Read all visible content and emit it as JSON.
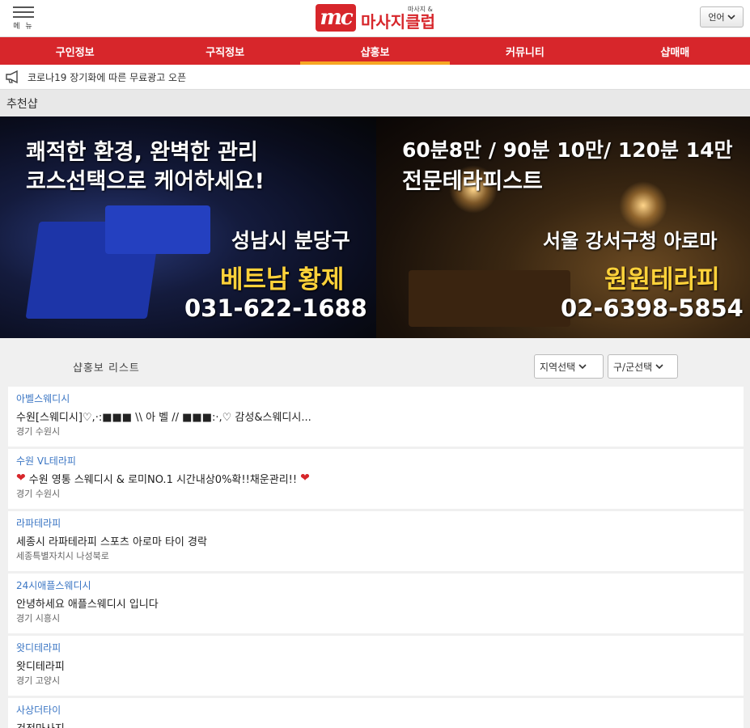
{
  "header": {
    "menu_label": "메 뉴",
    "logo_mark": "mc",
    "logo_sub": "마사지 &",
    "logo_main": "마사지클럽",
    "lang_label": "언어"
  },
  "nav": {
    "tabs": [
      {
        "label": "구인정보"
      },
      {
        "label": "구직정보"
      },
      {
        "label": "샵홍보"
      },
      {
        "label": "커뮤니티"
      },
      {
        "label": "샵매매"
      }
    ],
    "active_index": 2
  },
  "notice": {
    "text": "코로나19 장기화에 따른 무료광고 오픈"
  },
  "recommended": {
    "title": "추천샵"
  },
  "banners": [
    {
      "line1": "쾌적한 환경, 완벽한 관리",
      "line2": "코스선택으로 케어하세요!",
      "area": "성남시 분당구",
      "shop": "베트남 황제",
      "phone": "031-622-1688"
    },
    {
      "line1": "60분8만 / 90분 10만/ 120분 14만",
      "line2": "전문테라피스트",
      "area": "서울 강서구청 아로마",
      "shop": "원원테라피",
      "phone": "02-6398-5854"
    }
  ],
  "list": {
    "title": "샵홍보 리스트",
    "region_select": "지역선택",
    "district_select": "구/군선택",
    "items": [
      {
        "name": "아벨스웨디시",
        "desc": "수원[스웨디시]♡,·:■■■ \\\\ 아 벨 // ■■■:·,♡ 감성&스웨디시...",
        "loc": "경기 수원시"
      },
      {
        "name": "수원 VL테라피",
        "desc": "수원 영통 스웨디시 & 로미NO.1 시간내상0%확!!채운관리!!",
        "loc": "경기 수원시"
      },
      {
        "name": "라파테라피",
        "desc": "세종시 라파테라피 스포츠 아로마 타이 경락",
        "loc": "세종특별자치시 나성북로"
      },
      {
        "name": "24시애플스웨디시",
        "desc": "안녕하세요 애플스웨디시 입니다",
        "loc": "경기 시흥시"
      },
      {
        "name": "왓디테라피",
        "desc": "왓디테라피",
        "loc": "경기 고양시"
      },
      {
        "name": "사상더타이",
        "desc": "건전마사지",
        "loc": ""
      }
    ]
  },
  "colors": {
    "brand": "#d7262b",
    "accent": "#f6a623",
    "link": "#3b76c4"
  }
}
